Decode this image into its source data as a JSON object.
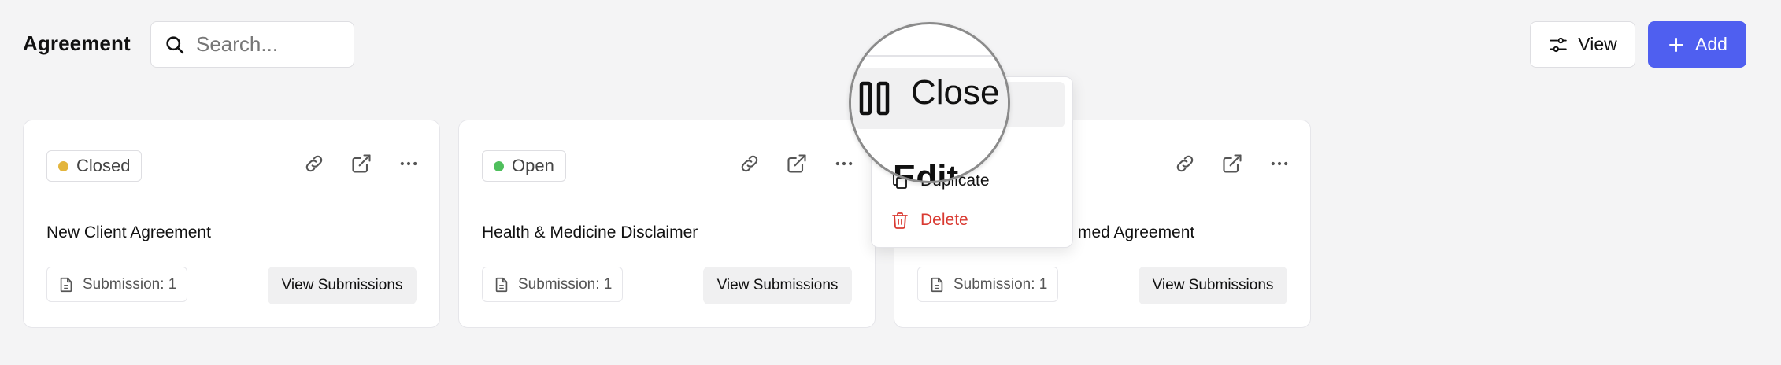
{
  "header": {
    "title": "Agreement",
    "search_placeholder": "Search...",
    "view_label": "View",
    "add_label": "Add"
  },
  "colors": {
    "accent": "#4f5ff0",
    "closed_dot": "#e3b53d",
    "open_dot": "#4fbf5c",
    "danger": "#d93a32"
  },
  "cards": [
    {
      "status": "Closed",
      "title": "New Client Agreement",
      "submissions": "Submission: 1",
      "view_submissions": "View Submissions"
    },
    {
      "status": "Open",
      "title": "Health & Medicine Disclaimer",
      "submissions": "Submission: 1",
      "view_submissions": "View Submissions"
    },
    {
      "status": "",
      "title": "med Agreement",
      "submissions": "Submission: 1",
      "view_submissions": "View Submissions"
    }
  ],
  "menu": {
    "close": "Close",
    "edit": "Edit",
    "duplicate": "Duplicate",
    "delete": "Delete"
  }
}
